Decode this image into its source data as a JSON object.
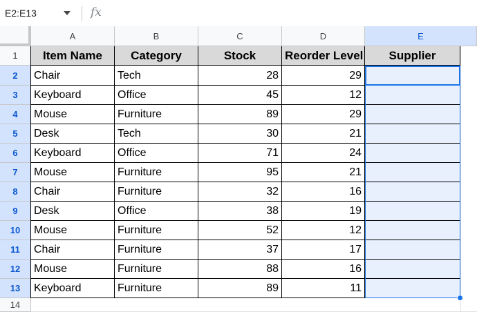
{
  "formula_bar": {
    "name_box": "E2:E13",
    "fx_label": "fx"
  },
  "columns": [
    "A",
    "B",
    "C",
    "D",
    "E"
  ],
  "rows": [
    "1",
    "2",
    "3",
    "4",
    "5",
    "6",
    "7",
    "8",
    "9",
    "10",
    "11",
    "12",
    "13",
    "14"
  ],
  "table": {
    "headers": [
      "Item Name",
      "Category",
      "Stock",
      "Reorder Level",
      "Supplier"
    ],
    "data": [
      [
        "Chair",
        "Tech",
        "28",
        "29",
        ""
      ],
      [
        "Keyboard",
        "Office",
        "45",
        "12",
        ""
      ],
      [
        "Mouse",
        "Furniture",
        "89",
        "29",
        ""
      ],
      [
        "Desk",
        "Tech",
        "30",
        "21",
        ""
      ],
      [
        "Keyboard",
        "Office",
        "71",
        "24",
        ""
      ],
      [
        "Mouse",
        "Furniture",
        "95",
        "21",
        ""
      ],
      [
        "Chair",
        "Furniture",
        "32",
        "16",
        ""
      ],
      [
        "Desk",
        "Office",
        "38",
        "19",
        ""
      ],
      [
        "Mouse",
        "Furniture",
        "52",
        "12",
        ""
      ],
      [
        "Chair",
        "Furniture",
        "37",
        "17",
        ""
      ],
      [
        "Mouse",
        "Furniture",
        "88",
        "16",
        ""
      ],
      [
        "Keyboard",
        "Furniture",
        "89",
        "11",
        ""
      ]
    ]
  },
  "selection": {
    "range": "E2:E13",
    "selected_column": "E",
    "selected_rows": [
      "2",
      "3",
      "4",
      "5",
      "6",
      "7",
      "8",
      "9",
      "10",
      "11",
      "12",
      "13"
    ],
    "accent_color": "#1a73e8"
  }
}
